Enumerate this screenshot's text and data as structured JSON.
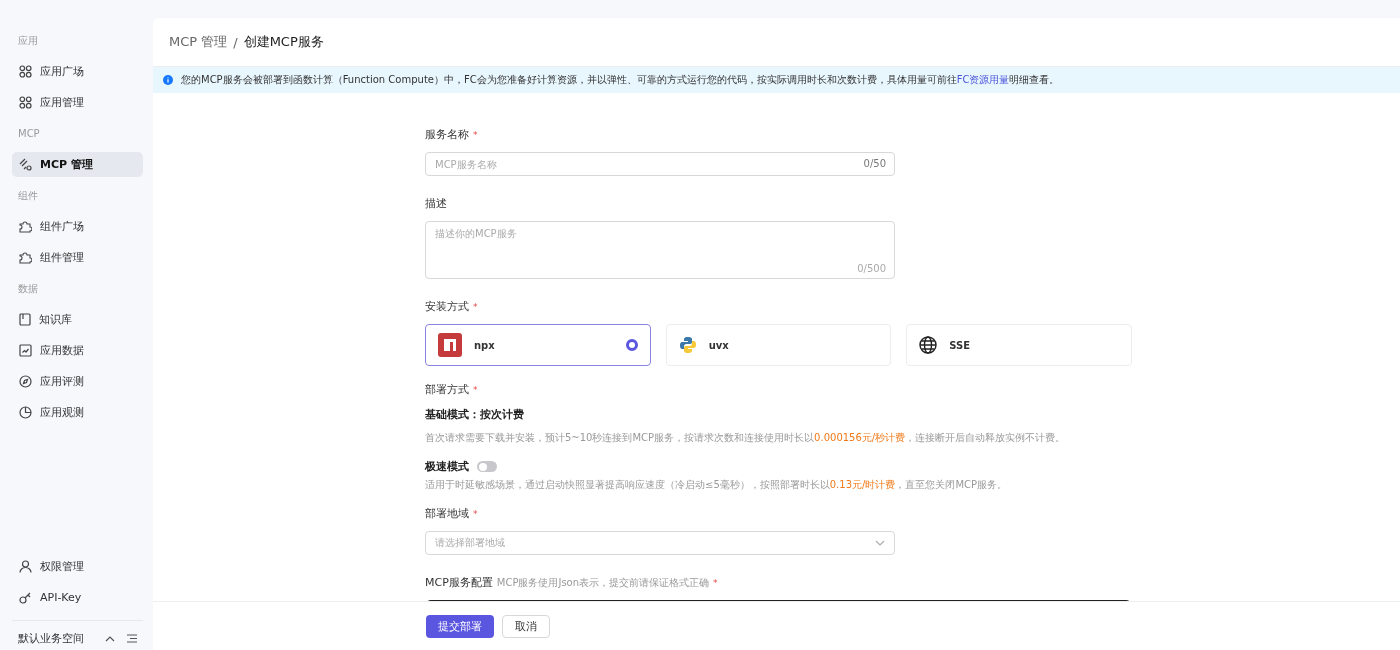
{
  "sidebar": {
    "sections": [
      {
        "heading": "应用",
        "items": [
          {
            "label": "应用广场",
            "kind": "grid",
            "selected": false
          },
          {
            "label": "应用管理",
            "kind": "grid",
            "selected": false
          }
        ]
      },
      {
        "heading": "MCP",
        "items": [
          {
            "label": "MCP 管理",
            "kind": "mcp",
            "selected": true
          }
        ]
      },
      {
        "heading": "组件",
        "items": [
          {
            "label": "组件广场",
            "kind": "puzzle",
            "selected": false
          },
          {
            "label": "组件管理",
            "kind": "puzzle",
            "selected": false
          }
        ]
      },
      {
        "heading": "数据",
        "items": [
          {
            "label": "知识库",
            "kind": "book",
            "selected": false
          },
          {
            "label": "应用数据",
            "kind": "chart",
            "selected": false
          },
          {
            "label": "应用评测",
            "kind": "compass",
            "selected": false
          },
          {
            "label": "应用观测",
            "kind": "pie",
            "selected": false
          }
        ]
      }
    ],
    "bottom_items": [
      {
        "label": "权限管理",
        "kind": "user",
        "selected": false
      },
      {
        "label": "API-Key",
        "kind": "key",
        "selected": false
      }
    ],
    "workspace": "默认业务空间"
  },
  "breadcrumb": {
    "parent": "MCP 管理",
    "separator": "/",
    "current": "创建MCP服务"
  },
  "notice": {
    "before": "您的MCP服务会被部署到函数计算（Function Compute）中，FC会为您准备好计算资源，并以弹性、可靠的方式运行您的代码，按实际调用时长和次数计费，具体用量可前往",
    "link": "FC资源用量",
    "after": "明细查看。"
  },
  "form": {
    "name": {
      "label": "服务名称",
      "required_mark": "*",
      "placeholder": "MCP服务名称",
      "count": "0/50"
    },
    "description": {
      "label": "描述",
      "placeholder": "描述你的MCP服务",
      "count": "0/500"
    },
    "install": {
      "label": "安装方式",
      "required_mark": "*",
      "options": [
        {
          "label": "npx",
          "kind": "npm",
          "selected": true
        },
        {
          "label": "uvx",
          "kind": "python",
          "selected": false
        },
        {
          "label": "SSE",
          "kind": "globe",
          "selected": false
        }
      ]
    },
    "deploy": {
      "label": "部署方式",
      "required_mark": "*",
      "basic": {
        "title": "基础模式：按次计费",
        "before": "首次请求需要下载并安装，预计5~10秒连接到MCP服务，按请求次数和连接使用时长以",
        "price": "0.000156元/秒计费",
        "after": "，连接断开后自动释放实例不计费。"
      },
      "fast": {
        "title": "极速模式",
        "on": false,
        "before": "适用于时延敏感场景，通过启动快照显著提高响应速度（冷启动≤5毫秒），按照部署时长以",
        "price": "0.13元/时计费",
        "after": "，直至您关闭MCP服务。"
      }
    },
    "region": {
      "label": "部署地域",
      "required_mark": "*",
      "placeholder": "请选择部署地域"
    },
    "config": {
      "label": "MCP服务配置",
      "hint": "MCP服务使用Json表示，提交前请保证格式正确",
      "required_mark": "*"
    }
  },
  "buttons": {
    "submit": "提交部署",
    "cancel": "取消"
  }
}
